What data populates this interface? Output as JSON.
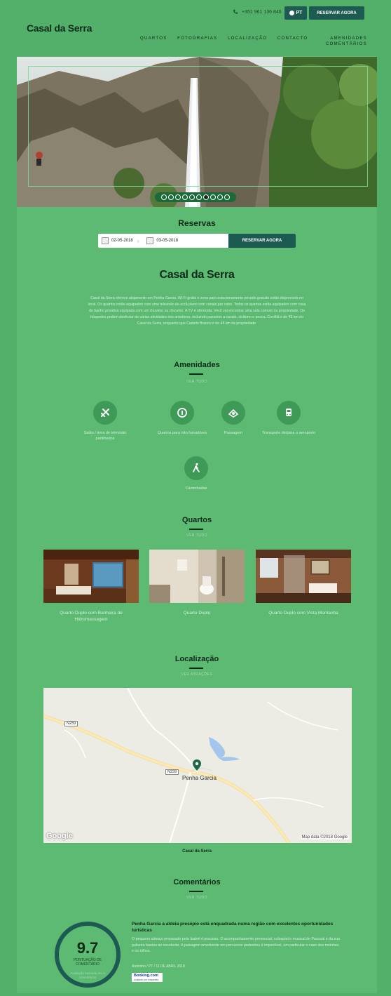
{
  "header": {
    "brand": "Casal da Serra",
    "phone": "+351 961 136 846",
    "language": "PT",
    "book_now": "RESERVAR AGORA",
    "nav": [
      "QUARTOS",
      "FOTOGRAFIAS",
      "LOCALIZAÇÃO",
      "CONTACTO",
      "AMENIDADES",
      "COMENTÁRIOS"
    ]
  },
  "hero": {
    "slide_count": 10,
    "active_slide": 7
  },
  "reservas": {
    "title": "Reservas",
    "checkin": "02-05-2018",
    "checkout": "03-05-2018",
    "button": "RESERVAR AGORA"
  },
  "about": {
    "title": "Casal da Serra",
    "description": "Casal da Serra oferece alojamento em Penha Garcia. Wi-Fi grátis e zona para estacionamento privado gratuito estão disponíveis no local. Os quartos estão equipados com uma televisão de ecrã plano com canais por cabo. Todos os quartos estão equipados com casa de banho privativa equipada com um chuveiro ou chuveiro. A TV é oferecida. Você vai encontrar uma sala comum na propriedade. Os hóspedes podem desfrutar de várias atividades nos arredores, incluindo passeios a cavalo, ciclismo e pesca. Covilhã é de 43 km do Casal da Serra, enquanto que Castelo Branco é de 48 km da propriedade."
  },
  "amenidades": {
    "title": "Amenidades",
    "see_all": "VER TUDO",
    "items": [
      {
        "icon": "tv-lounge-icon",
        "label": "Salão / área de televisão partilhados"
      },
      {
        "icon": "non-smoking-icon",
        "label": "Quartos para não fumadores"
      },
      {
        "icon": "laundry-icon",
        "label": "Passagem"
      },
      {
        "icon": "shuttle-icon",
        "label": "Transporte de/para o aeroporto"
      },
      {
        "icon": "hiking-icon",
        "label": "Caminhadas"
      }
    ]
  },
  "quartos": {
    "title": "Quartos",
    "see_all": "VER TUDO",
    "rooms": [
      {
        "label": "Quarto Duplo com Banheira de Hidromassagem"
      },
      {
        "label": "Quarto Duplo"
      },
      {
        "label": "Quarto Duplo com Vista Montanha"
      }
    ]
  },
  "localizacao": {
    "title": "Localização",
    "see_all": "VER ATRAÇÕES",
    "map_town": "Penha Garcia",
    "road_1": "N239",
    "road_2": "N239",
    "map_attribution": "Map data ©2018 Google",
    "google": "Google",
    "caption": "Casal da Serra"
  },
  "comentarios": {
    "title": "Comentários",
    "see_all": "VER TUDO",
    "score": "9.7",
    "score_label": "PONTUAÇÃO DE COMENTÁRIO",
    "score_sub": "Avaliação baseada em 3 comentários",
    "review_title": "Penha Garcia a aldeia presépio está enquadrada numa região com excelentes oportunidades turísticas",
    "review_text": "O pequeno almoço preparado pela Isabel é precioso. O acompanhamento presencial, coloquial e musical do Pascoal e da sua pulseira bastou ao excelente. A paisagem envolvente em percursos pedestres é imperdível, em particular o caso dos moinhos e os trilhos.",
    "review_meta": "Anónimo / PT / 11 DE ABRIL 2018",
    "booking": "Booking.com",
    "booking_sub": "avaliado por hóspedes"
  }
}
